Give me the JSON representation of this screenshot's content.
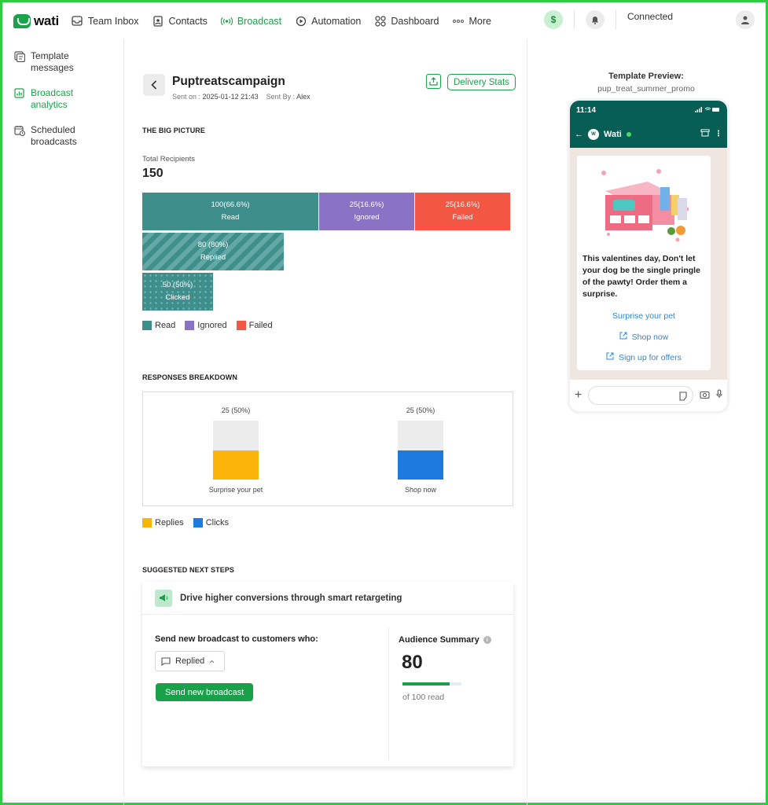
{
  "nav": {
    "logo": "wati",
    "items": [
      {
        "label": "Team Inbox"
      },
      {
        "label": "Contacts"
      },
      {
        "label": "Broadcast"
      },
      {
        "label": "Automation"
      },
      {
        "label": "Dashboard"
      },
      {
        "label": "More"
      }
    ],
    "connection_status": "Connected",
    "accent_color": "#1aa34a"
  },
  "sidebar": {
    "items": [
      {
        "label": "Template messages"
      },
      {
        "label": "Broadcast analytics"
      },
      {
        "label": "Scheduled broadcasts"
      }
    ]
  },
  "campaign": {
    "name": "Puptreatscampaign",
    "sent_on_label": "Sent on :",
    "sent_on": "2025-01-12 21:43",
    "sent_by_label": "Sent By :",
    "sent_by": "Alex",
    "delivery_stats_label": "Delivery Stats"
  },
  "big_picture": {
    "section_title": "THE BIG PICTURE",
    "total_label": "Total Recipients",
    "total_value": "150",
    "bars": [
      {
        "value": "100(66.6%)",
        "label": "Read",
        "count": 100,
        "color": "#3e8e8b"
      },
      {
        "value": "25(16.6%)",
        "label": "Ignored",
        "count": 25,
        "color": "#8a72c4"
      },
      {
        "value": "25(16.6%)",
        "label": "Failed",
        "count": 25,
        "color": "#f25744"
      },
      {
        "value": "80 (80%)",
        "label": "Replied",
        "count": 80
      },
      {
        "value": "50 (50%)",
        "label": "Clicked",
        "count": 50
      }
    ],
    "legend": [
      "Read",
      "Ignored",
      "Failed"
    ]
  },
  "responses": {
    "section_title": "RESPONSES BREAKDOWN",
    "columns": [
      {
        "value": "25 (50%)",
        "label": "Surprise your pet",
        "fraction": 0.5,
        "color": "#fbb40a"
      },
      {
        "value": "25 (50%)",
        "label": "Shop now",
        "fraction": 0.5,
        "color": "#1f7ae0"
      }
    ],
    "legend": [
      "Replies",
      "Clicks"
    ]
  },
  "suggested": {
    "section_title": "SUGGESTED NEXT STEPS",
    "card_title": "Drive higher conversions through smart retargeting",
    "send_label": "Send new broadcast to customers who:",
    "selected_filter": "Replied",
    "send_button": "Send new broadcast",
    "audience_title": "Audience Summary",
    "audience_value": "80",
    "audience_fraction": 0.8,
    "audience_sub": "of 100 read"
  },
  "preview": {
    "title": "Template Preview:",
    "template_name": "pup_treat_summer_promo",
    "time": "11:14",
    "contact": "Wati",
    "message": "This valentines day, Don't let your dog be the single pringle of the pawty! Order them a surprise.",
    "buttons": [
      "Surprise your pet",
      "Shop now",
      "Sign up for offers"
    ]
  }
}
